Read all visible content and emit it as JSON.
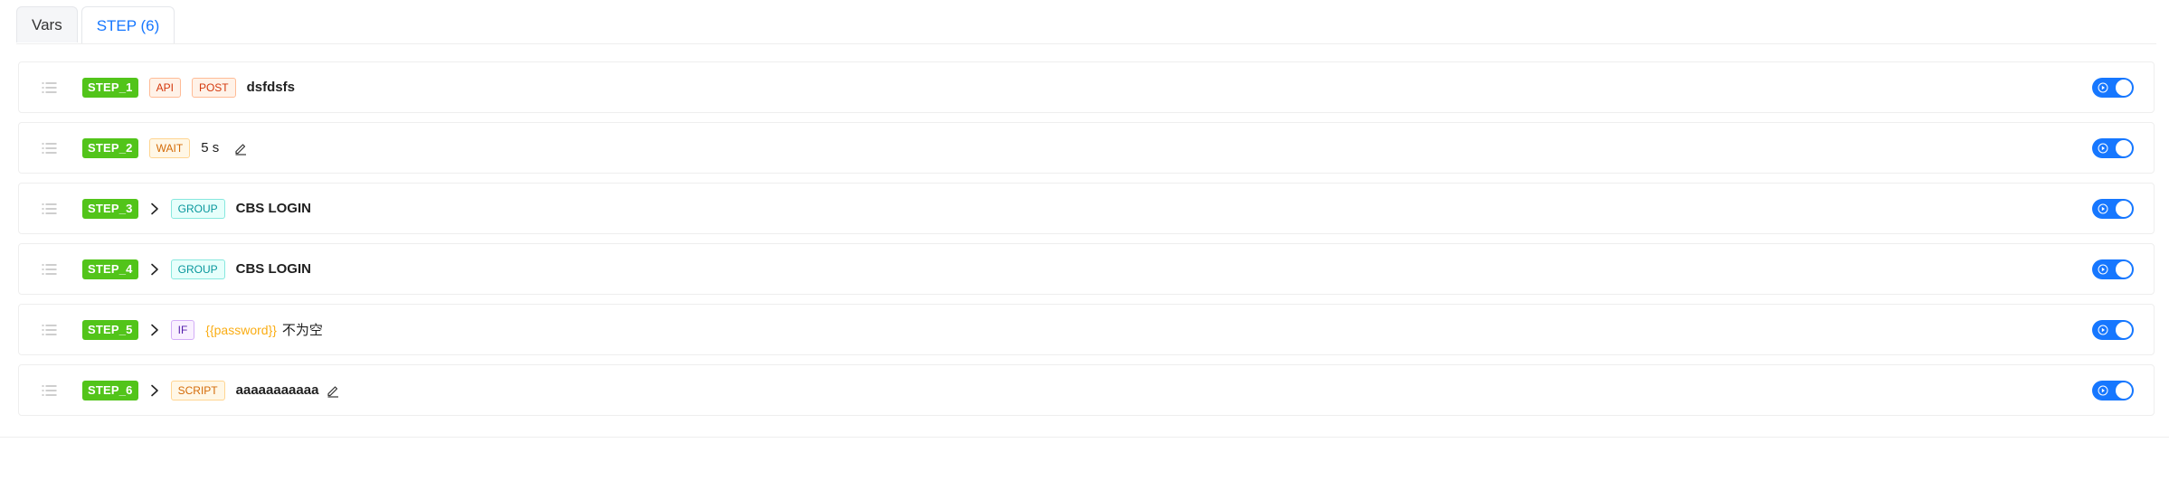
{
  "tabs": [
    {
      "label": "Vars",
      "active": false
    },
    {
      "label": "STEP (6)",
      "active": true
    }
  ],
  "colors": {
    "accent": "#1677ff",
    "step_tag": "#52c41a",
    "variable_text": "#faad14"
  },
  "steps": [
    {
      "id": "STEP_1",
      "tags": [
        "API",
        "POST"
      ],
      "text": "dsfdsfs",
      "enabled": true
    },
    {
      "id": "STEP_2",
      "tags": [
        "WAIT"
      ],
      "text": "5 s",
      "editable": true,
      "enabled": true
    },
    {
      "id": "STEP_3",
      "expandable": true,
      "tags": [
        "GROUP"
      ],
      "text": "CBS LOGIN",
      "enabled": true
    },
    {
      "id": "STEP_4",
      "expandable": true,
      "tags": [
        "GROUP"
      ],
      "text": "CBS LOGIN",
      "enabled": true
    },
    {
      "id": "STEP_5",
      "expandable": true,
      "tags": [
        "IF"
      ],
      "variable": "{{password}}",
      "text": "不为空",
      "enabled": true
    },
    {
      "id": "STEP_6",
      "expandable": true,
      "tags": [
        "SCRIPT"
      ],
      "text": "aaaaaaaaaaa",
      "editable": true,
      "enabled": true
    }
  ],
  "icons": {
    "drag": "drag-handle-icon",
    "expand": "chevron-right-icon",
    "edit": "edit-icon",
    "toggle": "play-circle-icon"
  }
}
